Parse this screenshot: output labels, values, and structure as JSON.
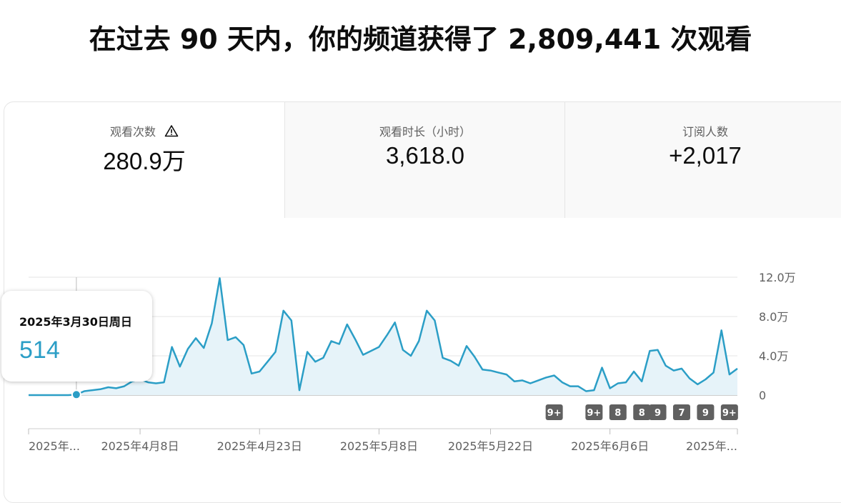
{
  "headline": "在过去 90 天内，你的频道获得了 2,809,441 次观看",
  "metrics": [
    {
      "label": "观看次数",
      "value": "280.9万",
      "warning_icon": "warning-triangle-icon"
    },
    {
      "label": "观看时长（小时）",
      "value": "3,618.0"
    },
    {
      "label": "订阅人数",
      "value": "+2,017"
    }
  ],
  "tooltip": {
    "date": "2025年3月30日周日",
    "value": "514"
  },
  "colors": {
    "line": "#2b9ec6",
    "fill": "#e6f3f9",
    "tooltip_value": "#2b9ec6",
    "badge": "#606060"
  },
  "chart_data": {
    "type": "area",
    "ylim": [
      0,
      120000
    ],
    "y_ticks": [
      0,
      40000,
      80000,
      120000
    ],
    "y_tick_labels": [
      "0",
      "4.0万",
      "8.0万",
      "12.0万"
    ],
    "x_tick_labels": [
      "2025年...",
      "2025年4月8日",
      "2025年4月23日",
      "2025年5月8日",
      "2025年5月22日",
      "2025年6月6日",
      "2025年..."
    ],
    "badges": [
      {
        "label": "9+",
        "day": 66
      },
      {
        "label": "9+",
        "day": 71
      },
      {
        "label": "8",
        "day": 74
      },
      {
        "label": "8",
        "day": 77
      },
      {
        "label": "9",
        "day": 79
      },
      {
        "label": "7",
        "day": 82
      },
      {
        "label": "9",
        "day": 85
      },
      {
        "label": "9+",
        "day": 88
      }
    ],
    "series": [
      {
        "values": [
          0,
          0,
          0,
          0,
          0,
          0,
          514,
          4000,
          5000,
          6000,
          8000,
          7000,
          9000,
          14000,
          16000,
          13000,
          12000,
          13000,
          49000,
          29000,
          47000,
          58000,
          48000,
          73000,
          119000,
          56000,
          59000,
          51000,
          22000,
          24000,
          34000,
          44000,
          86000,
          76000,
          5000,
          44000,
          34000,
          38000,
          55000,
          52000,
          72000,
          57000,
          41000,
          45000,
          49000,
          61000,
          74000,
          46000,
          40000,
          55000,
          86000,
          76000,
          38000,
          35000,
          30000,
          50000,
          39000,
          26000,
          25000,
          23000,
          21000,
          14000,
          15000,
          12000,
          15000,
          18000,
          20000,
          13000,
          9000,
          9000,
          4000,
          5000,
          28000,
          7000,
          12000,
          13000,
          24000,
          14000,
          45000,
          46000,
          30000,
          25000,
          27000,
          17000,
          11000,
          16000,
          23000,
          66000,
          21000,
          27000
        ]
      }
    ]
  }
}
